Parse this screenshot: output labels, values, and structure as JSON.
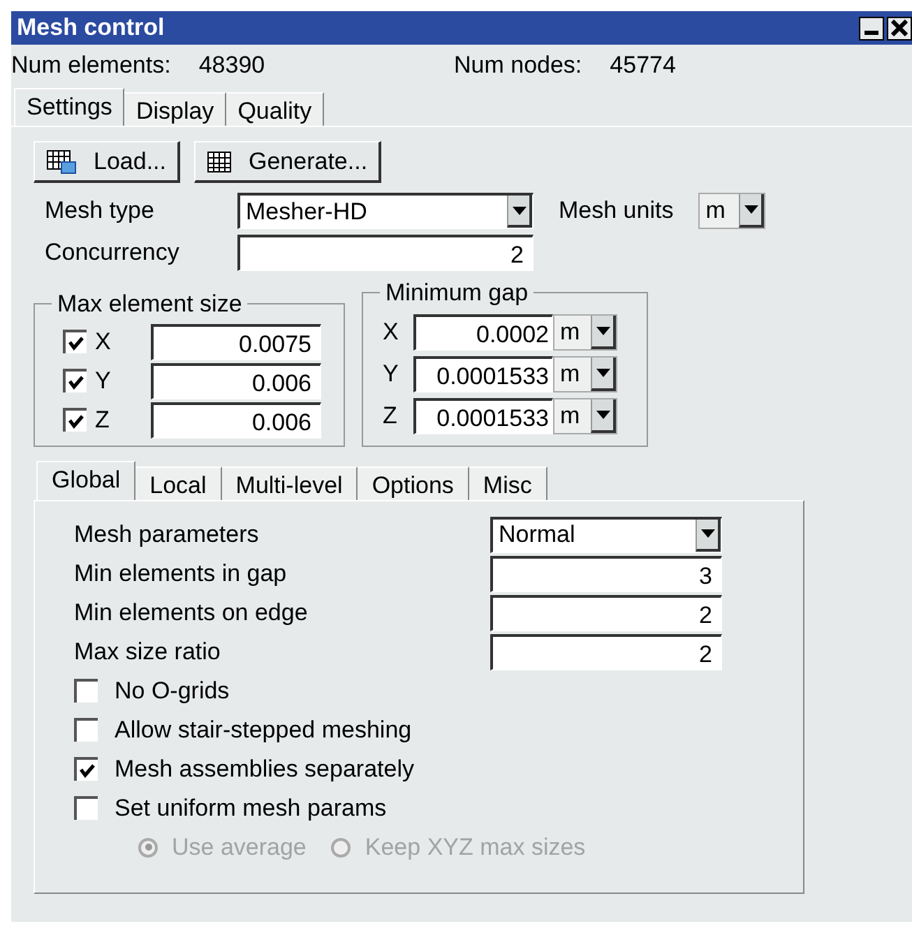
{
  "window": {
    "title": "Mesh control"
  },
  "stats": [
    {
      "label": "Num elements:",
      "value": "48390"
    },
    {
      "label": "Num nodes:",
      "value": "45774"
    }
  ],
  "tabs": [
    {
      "label": "Settings",
      "selected": true
    },
    {
      "label": "Display",
      "selected": false
    },
    {
      "label": "Quality",
      "selected": false
    }
  ],
  "buttons": [
    {
      "label": "Load...",
      "kind": "load"
    },
    {
      "label": "Generate...",
      "kind": "generate"
    }
  ],
  "mesh_type": {
    "label": "Mesh type",
    "value": "Mesher-HD"
  },
  "mesh_units": {
    "label": "Mesh units",
    "value": "m"
  },
  "concurrency": {
    "label": "Concurrency",
    "value": "2"
  },
  "max_element_size": {
    "title": "Max element size",
    "rows": [
      {
        "axis": "X",
        "checked": true,
        "value": "0.0075"
      },
      {
        "axis": "Y",
        "checked": true,
        "value": "0.006"
      },
      {
        "axis": "Z",
        "checked": true,
        "value": "0.006"
      }
    ]
  },
  "minimum_gap": {
    "title": "Minimum gap",
    "rows": [
      {
        "axis": "X",
        "value": "0.0002",
        "unit": "m"
      },
      {
        "axis": "Y",
        "value": "0.0001533",
        "unit": "m"
      },
      {
        "axis": "Z",
        "value": "0.0001533",
        "unit": "m"
      }
    ]
  },
  "inner_tabs": [
    {
      "label": "Global",
      "selected": true
    },
    {
      "label": "Local",
      "selected": false
    },
    {
      "label": "Multi-level",
      "selected": false
    },
    {
      "label": "Options",
      "selected": false
    },
    {
      "label": "Misc",
      "selected": false
    }
  ],
  "parameters": [
    {
      "label": "Mesh parameters",
      "value": "Normal",
      "kind": "dropdown"
    },
    {
      "label": "Min elements in gap",
      "value": "3",
      "kind": "field"
    },
    {
      "label": "Min elements on edge",
      "value": "2",
      "kind": "field"
    },
    {
      "label": "Max size ratio",
      "value": "2",
      "kind": "field"
    }
  ],
  "options": [
    {
      "label": "No O-grids",
      "checked": false
    },
    {
      "label": "Allow stair-stepped meshing",
      "checked": false
    },
    {
      "label": "Mesh assemblies separately",
      "checked": true
    },
    {
      "label": "Set uniform mesh params",
      "checked": false
    }
  ],
  "radios": [
    {
      "label": "Use average",
      "selected": true,
      "disabled": true
    },
    {
      "label": "Keep XYZ max sizes",
      "selected": false,
      "disabled": true
    }
  ]
}
